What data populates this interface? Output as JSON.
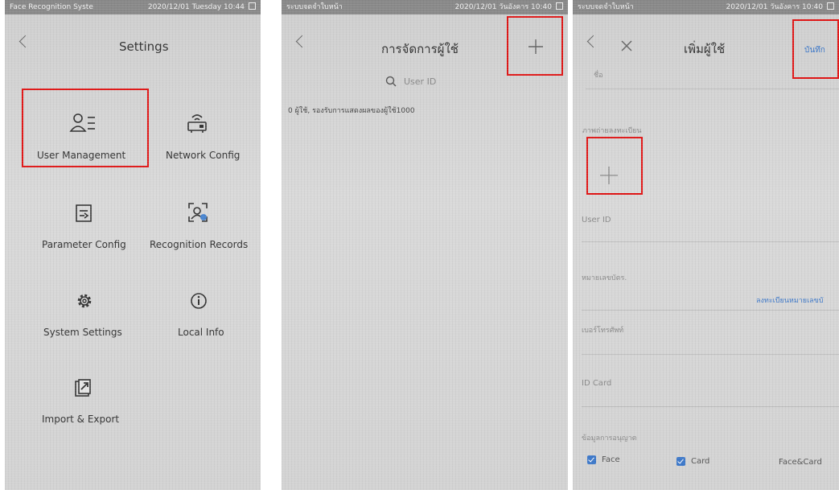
{
  "settings": {
    "status_left": "Face Recognition Syste",
    "status_right": "2020/12/01 Tuesday 10:44",
    "title": "Settings",
    "tiles": [
      {
        "label": "User Management",
        "icon": "user-list-icon"
      },
      {
        "label": "Network Config",
        "icon": "router-icon"
      },
      {
        "label": "Parameter Config",
        "icon": "parameter-icon"
      },
      {
        "label": "Recognition Records",
        "icon": "face-scan-icon"
      },
      {
        "label": "System Settings",
        "icon": "gear-icon"
      },
      {
        "label": "Local Info",
        "icon": "info-icon"
      },
      {
        "label": "Import & Export",
        "icon": "import-export-icon"
      }
    ]
  },
  "users": {
    "status_left": "ระบบจดจำใบหน้า",
    "status_right": "2020/12/01 วันอังคาร 10:40",
    "title": "การจัดการผู้ใช้",
    "search_placeholder": "User ID",
    "info": "0 ผู้ใช้,  รองรับการแสดงผลของผู้ใช้1000"
  },
  "add_user": {
    "status_left": "ระบบจดจำใบหน้า",
    "status_right": "2020/12/01 วันอังคาร 10:40",
    "title": "เพิ่มผู้ใช้",
    "save_label": "บันทึก",
    "name_label": "ชื่อ",
    "photo_label": "ภาพถ่ายลงทะเบียน",
    "user_id_label": "User ID",
    "card_no_label": "หมายเลขบัตร.",
    "register_card_link": "ลงทะเบียนหมายเลขบั",
    "phone_label": "เบอร์โทรศัพท์",
    "id_card_label": "ID Card",
    "permission_label": "ข้อมูลการอนุญาต",
    "opt_face": "Face",
    "opt_card": "Card",
    "opt_face_card": "Face&Card"
  },
  "colors": {
    "highlight": "#e01515",
    "accent": "#3d78c9"
  }
}
